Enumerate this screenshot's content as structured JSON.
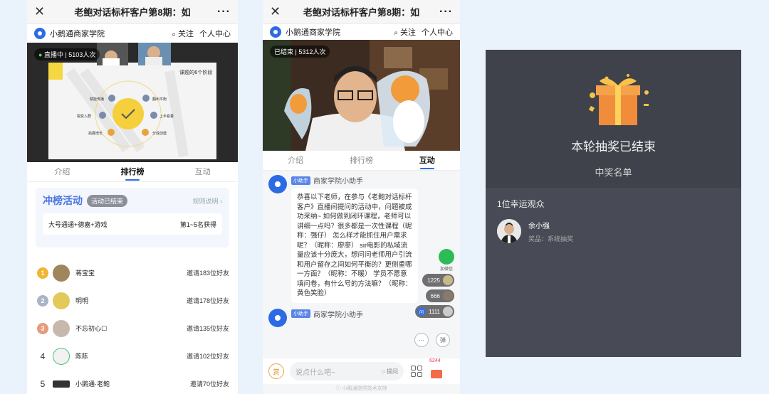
{
  "left": {
    "title": "老鲍对话标杆客户第8期：如",
    "brand": "小鹅通商家学院",
    "follow": "关注",
    "personal": "个人中心",
    "live_badge": "直播中 | 5103人次",
    "slide": {
      "title": "课题的6个阶段",
      "left_labels": [
        "赋能传播",
        "裂变入群",
        "拓展增长"
      ],
      "right_labels": [
        "翻出平衡",
        "上半看着",
        "分成创建"
      ]
    },
    "tabs": [
      "介绍",
      "排行榜",
      "互动"
    ],
    "contest": {
      "title": "冲榜活动",
      "status": "活动已结束",
      "rules": "规则说明",
      "prize": "大号通通+德嘉+游戏",
      "prize_rank": "第1~5名获得"
    },
    "ranking": [
      {
        "rank": "1",
        "name": "蒋宝宝",
        "invite": "邀请183位好友"
      },
      {
        "rank": "2",
        "name": "明明",
        "invite": "邀请178位好友"
      },
      {
        "rank": "3",
        "name": "不忘初心☐",
        "invite": "邀请135位好友"
      },
      {
        "rank": "4",
        "name": "陈陈",
        "invite": "邀请102位好友"
      },
      {
        "rank": "5",
        "name": "小鹅通·老鲍",
        "invite": "邀请70位好友"
      }
    ]
  },
  "middle": {
    "title": "老鲍对话标杆客户第8期：如",
    "brand": "小鹅通商家学院",
    "follow": "关注",
    "personal": "个人中心",
    "ended_badge": "已结束 | 5312人次",
    "tabs": [
      "介绍",
      "排行榜",
      "互动"
    ],
    "messages": [
      {
        "tag": "小助手",
        "sender": "商家学院小助手",
        "text": "恭喜以下老师，在参与《老鲍对话标杆客户》直播间提问的活动中，问题被成功采纳~ 如何做到闭环课程，老师可以讲细一点吗？很多都是一次性课程（昵称：强仔） 怎么样才能抓住用户需求呢？（昵称：廖廖） sir电影的私域流量应该十分庞大，想问问老师用户引流和用户留存之间如何平衡的？更侧重哪一方面？（昵称：不暖） 学员不愿意填问卷，有什么号的方法嘛？（昵称：黄色笑脸）"
      },
      {
        "tag": "小助手",
        "sender": "商家学院小助手",
        "text": ""
      }
    ],
    "wechat_label": "加微信",
    "counts": [
      "1225",
      "666",
      "1111"
    ],
    "bullet_btn": "弹",
    "input_placeholder": "说点什么吧~",
    "ask_label": "提问",
    "reward_label": "赏",
    "likes": "6244",
    "footer": "小鹅通提供技术支持"
  },
  "right": {
    "title": "本轮抽奖已结束",
    "subtitle": "中奖名单",
    "lucky_count": "1位幸运观众",
    "winner_name": "余小强",
    "winner_prize": "奖品：系统抽奖"
  }
}
